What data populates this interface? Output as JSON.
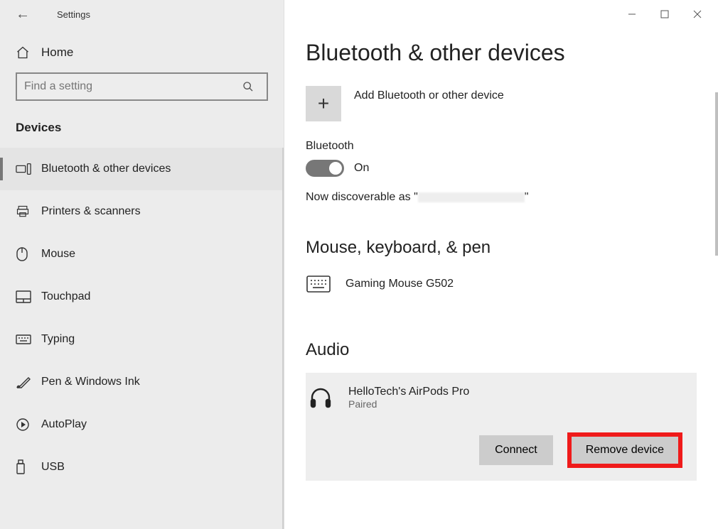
{
  "app_title": "Settings",
  "home_label": "Home",
  "search_placeholder": "Find a setting",
  "section_title": "Devices",
  "nav": [
    {
      "key": "bluetooth",
      "label": "Bluetooth & other devices",
      "selected": true
    },
    {
      "key": "printers",
      "label": "Printers & scanners"
    },
    {
      "key": "mouse",
      "label": "Mouse"
    },
    {
      "key": "touchpad",
      "label": "Touchpad"
    },
    {
      "key": "typing",
      "label": "Typing"
    },
    {
      "key": "pen",
      "label": "Pen & Windows Ink"
    },
    {
      "key": "autoplay",
      "label": "AutoPlay"
    },
    {
      "key": "usb",
      "label": "USB"
    }
  ],
  "page_title": "Bluetooth & other devices",
  "add_device_label": "Add Bluetooth or other device",
  "bluetooth_label": "Bluetooth",
  "bluetooth_state": "On",
  "discoverable_prefix": "Now discoverable as \"",
  "discoverable_suffix": "\"",
  "group_mouse_title": "Mouse, keyboard, & pen",
  "mouse_device_name": "Gaming Mouse G502",
  "group_audio_title": "Audio",
  "audio_device_name": "HelloTech's AirPods Pro",
  "audio_device_status": "Paired",
  "connect_label": "Connect",
  "remove_label": "Remove device"
}
